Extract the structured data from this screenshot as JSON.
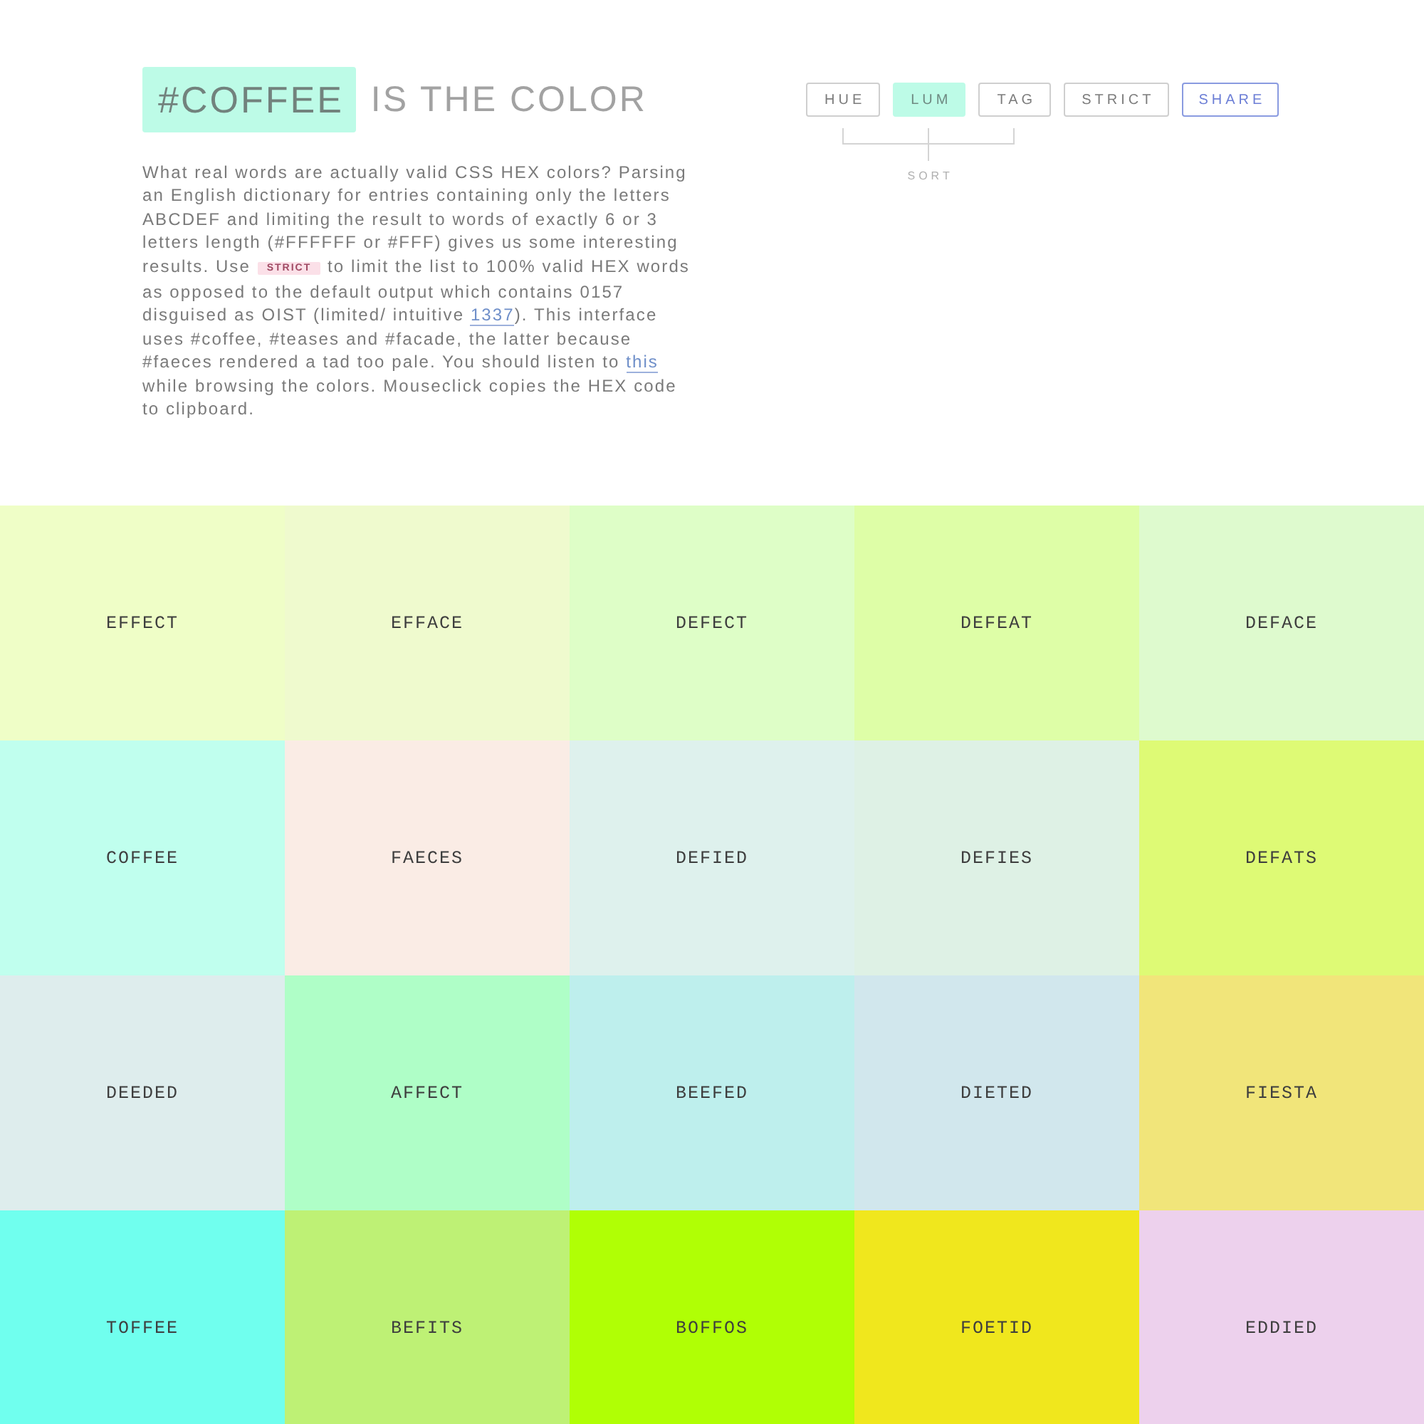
{
  "title": {
    "highlight": "#COFFEE",
    "text": "IS THE COLOR"
  },
  "intro": [
    {
      "kind": "text",
      "text": "What real words are actually valid CSS HEX colors? Parsing an English dictionary for entries containing only the letters ABCDEF and limiting the result to words of exactly 6 or 3 letters length (#FFFFFF or #FFF) gives us some interesting results. Use "
    },
    {
      "kind": "tag",
      "text": "STRICT"
    },
    {
      "kind": "text",
      "text": " to limit the list to 100% valid HEX words as opposed to the default output which contains 0157 disguised as OIST (limited/ intuitive "
    },
    {
      "kind": "link",
      "text": "1337"
    },
    {
      "kind": "text",
      "text": "). This interface uses #coffee, #teases and #facade, the latter because #faeces rendered a tad too pale. You should listen to "
    },
    {
      "kind": "link",
      "text": "this"
    },
    {
      "kind": "text",
      "text": " while browsing the colors. Mouseclick copies the HEX code to clipboard."
    }
  ],
  "sort": {
    "label": "SORT",
    "options": [
      {
        "label": "HUE",
        "selected": false
      },
      {
        "label": "LUM",
        "selected": true
      },
      {
        "label": "TAG",
        "selected": false
      }
    ]
  },
  "strict": {
    "label": "STRICT",
    "on": false
  },
  "share": {
    "label": "SHARE"
  },
  "tiles": [
    {
      "word": "EFFECT",
      "color": "#effec7"
    },
    {
      "word": "EFFACE",
      "color": "#efface"
    },
    {
      "word": "DEFECT",
      "color": "#defec7"
    },
    {
      "word": "DEFEAT",
      "color": "#defea7"
    },
    {
      "word": "DEFACE",
      "color": "#deface"
    },
    {
      "word": "COFFEE",
      "color": "#c0ffee"
    },
    {
      "word": "FAECES",
      "color": "#faece5"
    },
    {
      "word": "DEFIED",
      "color": "#def1ed"
    },
    {
      "word": "DEFIES",
      "color": "#def1e5"
    },
    {
      "word": "DEFATS",
      "color": "#defa75"
    },
    {
      "word": "DEEDED",
      "color": "#deeded"
    },
    {
      "word": "AFFECT",
      "color": "#affec7"
    },
    {
      "word": "BEEFED",
      "color": "#beefed"
    },
    {
      "word": "DIETED",
      "color": "#d1e7ed"
    },
    {
      "word": "FIESTA",
      "color": "#f1e57a"
    },
    {
      "word": "TOFFEE",
      "color": "#70ffee"
    },
    {
      "word": "BEFITS",
      "color": "#bef175"
    },
    {
      "word": "BOFFOS",
      "color": "#b0ff05"
    },
    {
      "word": "FOETID",
      "color": "#f0e71d"
    },
    {
      "word": "EDDIED",
      "color": "#edd1ed"
    }
  ]
}
